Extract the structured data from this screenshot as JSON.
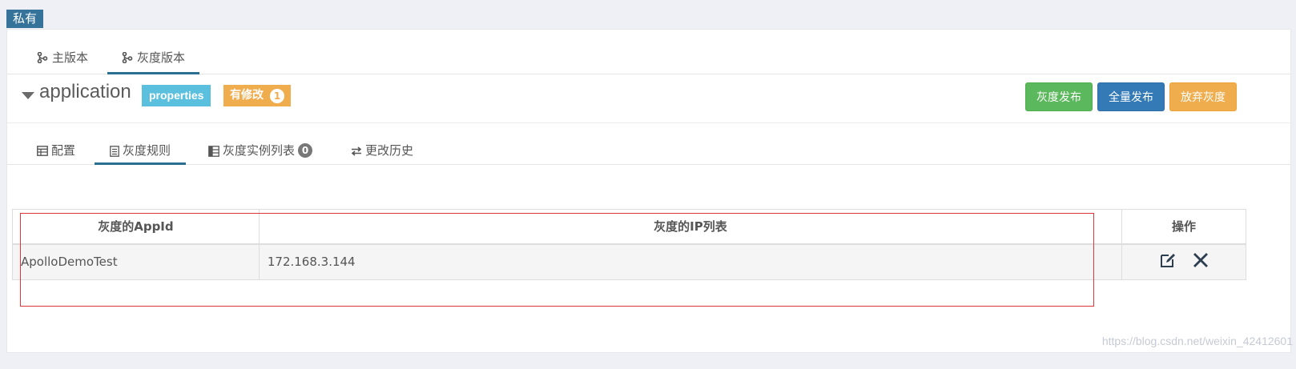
{
  "scope_badge": "私有",
  "version_tabs": [
    {
      "label": "主版本",
      "icon": "branch-icon",
      "active": false
    },
    {
      "label": "灰度版本",
      "icon": "branch-icon",
      "active": true
    }
  ],
  "namespace": {
    "name": "application",
    "format_badge": "properties",
    "modified_label": "有修改",
    "modified_count": "1"
  },
  "actions": {
    "gray_publish": "灰度发布",
    "full_publish": "全量发布",
    "abandon_gray": "放弃灰度"
  },
  "sub_tabs": [
    {
      "label": "配置",
      "icon": "table-icon",
      "active": false
    },
    {
      "label": "灰度规则",
      "icon": "document-icon",
      "active": true
    },
    {
      "label": "灰度实例列表",
      "icon": "list-icon",
      "badge": "0",
      "active": false
    },
    {
      "label": "更改历史",
      "icon": "swap-icon",
      "active": false
    }
  ],
  "rules_table": {
    "headers": {
      "appid": "灰度的AppId",
      "ip_list": "灰度的IP列表",
      "ops": "操作"
    },
    "rows": [
      {
        "appid": "ApolloDemoTest",
        "ip_list": "172.168.3.144"
      }
    ]
  },
  "watermark": "https://blog.csdn.net/weixin_42412601",
  "colors": {
    "scope_badge": "#35739a",
    "tab_active": "#2a6f90",
    "format_badge": "#5bc0de",
    "modified_badge": "#f0ad4e",
    "gray_publish": "#5cb85c",
    "full_publish": "#337ab7",
    "abandon": "#f0ad4e",
    "highlight": "#e0353b"
  }
}
